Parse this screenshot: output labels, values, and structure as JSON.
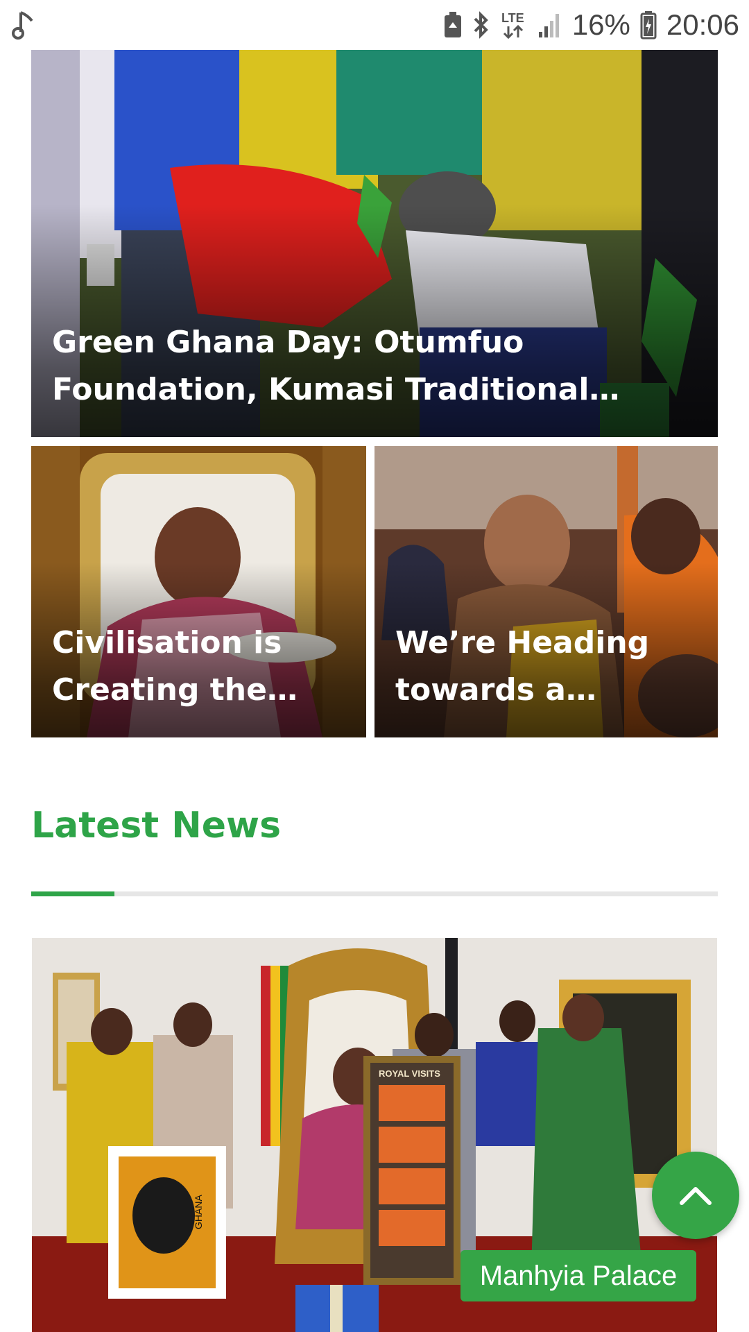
{
  "status_bar": {
    "battery": "16%",
    "time": "20:06",
    "network": "LTE",
    "icons": [
      "music-note-icon",
      "battery-saver-icon",
      "bluetooth-icon",
      "lte-icon",
      "signal-icon",
      "battery-icon"
    ]
  },
  "featured": {
    "hero": {
      "title": "Green Ghana Day: Otumfuo Foundation, Kumasi Traditional…"
    },
    "cards": [
      {
        "title": "Civilisation is Creating the…"
      },
      {
        "title": "We’re Heading towards a…"
      }
    ]
  },
  "latest_news": {
    "heading": "Latest News",
    "article": {
      "category": "Manhyia Palace",
      "poster_text": "ROYAL VISITS",
      "stamp_text": "GHANA"
    }
  },
  "colors": {
    "accent": "#2ea448",
    "pill": "#35a547",
    "status_text": "#444444"
  }
}
